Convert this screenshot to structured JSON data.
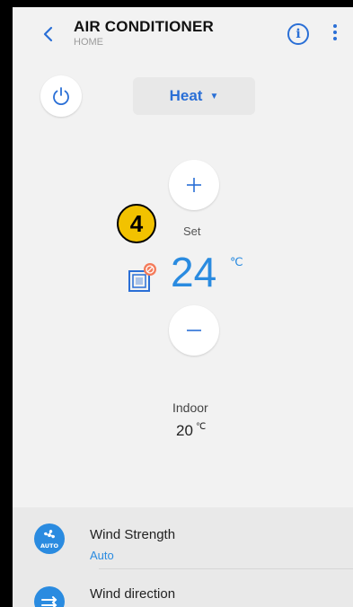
{
  "header": {
    "title": "AIR CONDITIONER",
    "subtitle": "HOME"
  },
  "mode": {
    "label": "Heat"
  },
  "setpoint": {
    "label": "Set",
    "value": "24",
    "unit": "℃"
  },
  "step_badge": {
    "number": "4"
  },
  "indoor": {
    "label": "Indoor",
    "value": "20",
    "unit": "℃"
  },
  "options": [
    {
      "title": "Wind Strength",
      "value": "Auto",
      "icon_text": "AUTO"
    },
    {
      "title": "Wind direction"
    }
  ],
  "colors": {
    "accent": "#2a6fd6",
    "temp": "#2a8be0",
    "badge": "#f2c200",
    "warning": "#f47b5a"
  }
}
